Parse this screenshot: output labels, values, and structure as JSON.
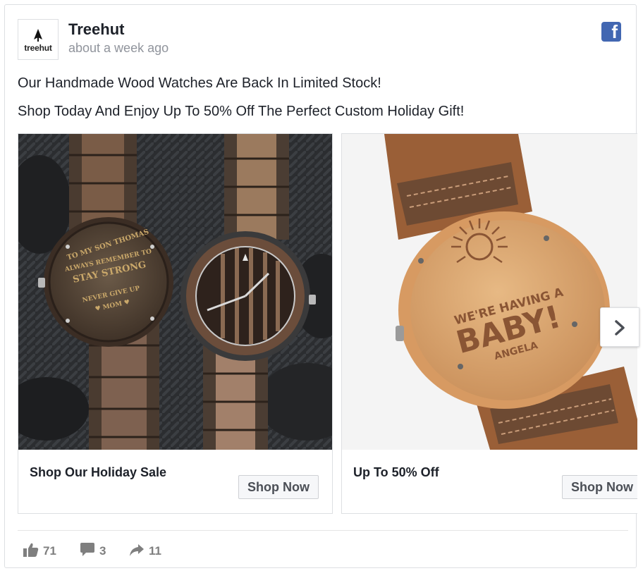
{
  "post": {
    "page_name": "Treehut",
    "logo_text": "treehut",
    "timestamp": "about a week ago",
    "message_line1": "Our Handmade Wood Watches Are Back In Limited Stock!",
    "message_line2": "Shop Today And Enjoy Up To 50% Off The Perfect Custom Holiday Gift!"
  },
  "carousel": {
    "cards": [
      {
        "headline": "Shop Our Holiday Sale",
        "cta": "Shop Now"
      },
      {
        "headline": "Up To 50% Off",
        "cta": "Shop Now"
      }
    ],
    "engraving1": {
      "line1": "TO MY SON THOMAS",
      "line2": "ALWAYS REMEMBER TO",
      "line3": "STAY STRONG",
      "line4": "NEVER GIVE UP",
      "line5": "♥ MOM ♥"
    },
    "engraving2": {
      "line1": "WE'RE HAVING A",
      "line2": "BABY!",
      "line3": "ANGELA"
    }
  },
  "engagement": {
    "likes": "71",
    "comments": "3",
    "shares": "11"
  },
  "colors": {
    "facebook_blue": "#4267b2",
    "meta_gray": "#90949c",
    "stat_gray": "#7f7f7f"
  },
  "icons": [
    "tree-logo-icon",
    "facebook-icon",
    "chevron-right-icon",
    "like-icon",
    "comment-icon",
    "share-icon"
  ]
}
